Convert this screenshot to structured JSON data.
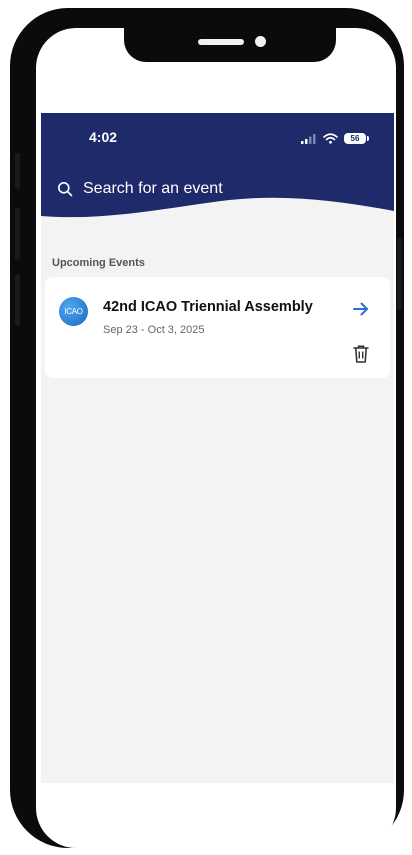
{
  "status_bar": {
    "time": "4:02",
    "battery": "56",
    "icons": [
      "cellular-signal-icon",
      "wifi-icon",
      "battery-icon"
    ]
  },
  "search": {
    "placeholder": "Search for an event",
    "icon": "search-icon"
  },
  "upcoming": {
    "section_title": "Upcoming Events",
    "events": [
      {
        "logo_text": "ICAO",
        "title": "42nd ICAO Triennial Assembly",
        "dates": "Sep 23 - Oct 3, 2025",
        "open_icon": "arrow-right-icon",
        "delete_icon": "trash-icon"
      }
    ]
  },
  "colors": {
    "header_navy": "#1f2a6b",
    "accent_blue": "#2a6fd6",
    "background": "#f3f3f3",
    "card": "#ffffff"
  }
}
